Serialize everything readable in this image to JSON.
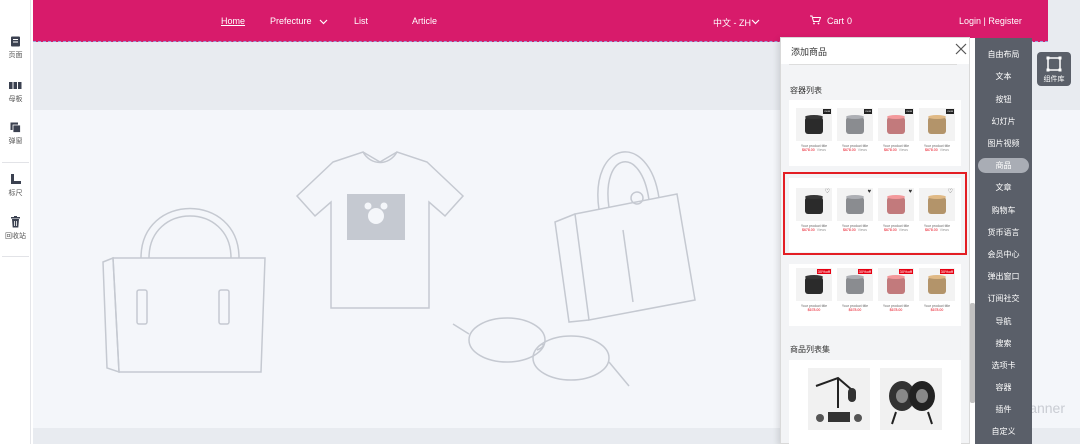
{
  "left_toolbar": {
    "items": [
      {
        "label": "页面",
        "icon": "page-icon"
      },
      {
        "label": "母板",
        "icon": "master-icon"
      },
      {
        "label": "弹窗",
        "icon": "popup-icon"
      },
      {
        "label": "标尺",
        "icon": "ruler-icon"
      },
      {
        "label": "回收站",
        "icon": "trash-icon"
      }
    ]
  },
  "site_nav": {
    "home": "Home",
    "prefecture": "Prefecture",
    "list": "List",
    "article": "Article",
    "language": "中文 - ZH",
    "cart_label": "Cart",
    "cart_count": "0",
    "login": "Login | Register",
    "bg_color": "#d81b6b"
  },
  "banner": {
    "text": "anner"
  },
  "panel": {
    "title": "添加商品",
    "section_container_list": "容器列表",
    "section_product_list_set": "商品列表集",
    "product_title": "Your product title",
    "product_price": "$678.00",
    "product_old_price": "Views",
    "tag_new": "new",
    "tag_sale": "30%off"
  },
  "component_menu": {
    "items": [
      "自由布局",
      "文本",
      "按钮",
      "幻灯片",
      "图片视频",
      "商品",
      "文章",
      "购物车",
      "货币语言",
      "会员中心",
      "弹出窗口",
      "订阅社交",
      "导航",
      "搜索",
      "选项卡",
      "容器",
      "插件",
      "自定义"
    ],
    "active": "商品"
  },
  "library_button": {
    "label": "组件库"
  }
}
